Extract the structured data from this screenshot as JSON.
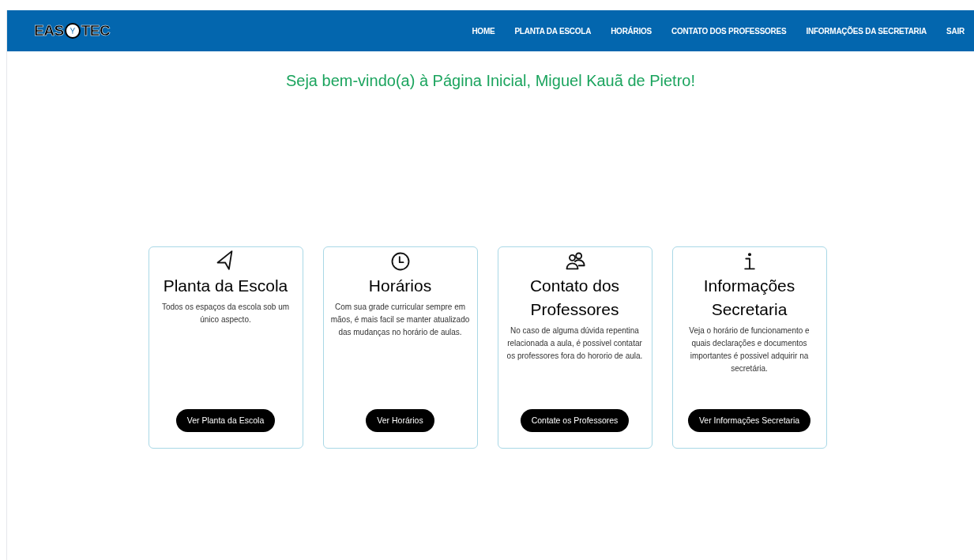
{
  "logo": {
    "before": "EAS",
    "mark": "Y",
    "after": "TEC"
  },
  "nav": [
    "HOME",
    "PLANTA DA ESCOLA",
    "HORÁRIOS",
    "CONTATO DOS PROFESSORES",
    "INFORMAÇÕES DA SECRETARIA",
    "SAIR"
  ],
  "welcome": "Seja bem-vindo(a) à Página Inicial, Miguel Kauã de Pietro!",
  "cards": [
    {
      "kind": "navigation",
      "title": "Planta da Escola",
      "text": "Todos os espaços da escola sob um único aspecto.",
      "button": "Ver Planta da Escola"
    },
    {
      "kind": "clock",
      "title": "Horários",
      "text": "Com sua grade curricular sempre em mãos, é mais facil se manter atualizado das mudanças no horário de aulas.",
      "button": "Ver Horários"
    },
    {
      "kind": "users",
      "title": "Contato dos Professores",
      "text": "No caso de alguma dúvida repentina relacionada a aula, é possivel contatar os professores fora do hororio de aula.",
      "button": "Contate os Professores"
    },
    {
      "kind": "info",
      "title": "Informações Secretaria",
      "text": "Veja o horário de funcionamento e quais declarações e documentos importantes é possivel adquirir na secretária.",
      "button": "Ver Informações Secretaria"
    }
  ]
}
